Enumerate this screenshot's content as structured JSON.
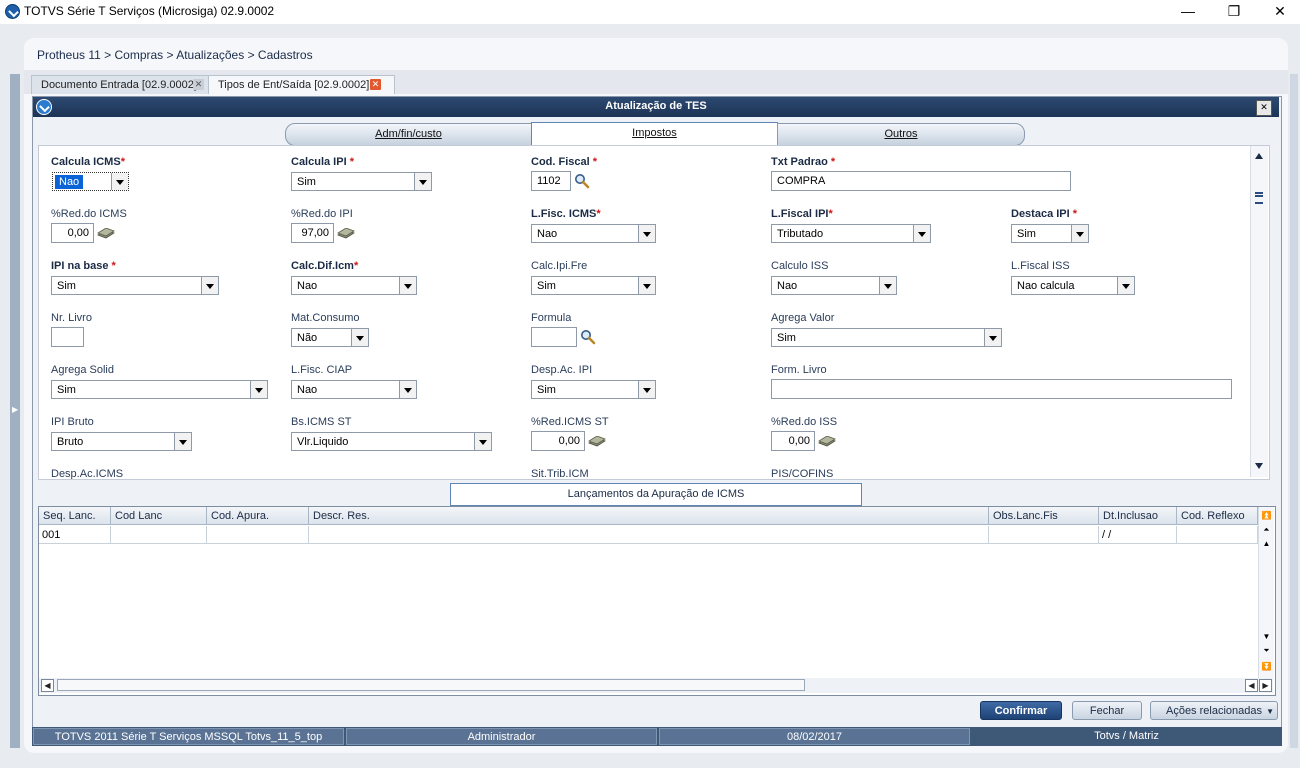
{
  "window": {
    "title": "TOTVS Série T Serviços (Microsiga) 02.9.0002",
    "minimize": "—",
    "maximize": "❐",
    "close": "✕"
  },
  "breadcrumb": "Protheus 11 > Compras  > Atualizações > Cadastros",
  "tabs": [
    {
      "label": "Documento Entrada [02.9.0002]",
      "close": "✕"
    },
    {
      "label": "Tipos de Ent/Saída [02.9.0002]",
      "close": "✕"
    }
  ],
  "dialog": {
    "title": "Atualização de TES",
    "close": "✕"
  },
  "folder_tabs": [
    "Adm/fin/custo",
    "Impostos",
    "Outros"
  ],
  "required_mark": "*",
  "fields": {
    "calcula_icms": {
      "label": "Calcula ICMS",
      "value": "Nao"
    },
    "calcula_ipi": {
      "label": "Calcula IPI ",
      "value": "Sim"
    },
    "cod_fiscal": {
      "label": "Cod. Fiscal ",
      "value": "1102"
    },
    "txt_padrao": {
      "label": "Txt Padrao ",
      "value": "COMPRA"
    },
    "red_icms": {
      "label": "%Red.do ICMS",
      "value": "0,00"
    },
    "red_ipi": {
      "label": "%Red.do IPI",
      "value": "97,00"
    },
    "lfisc_icms": {
      "label": "L.Fisc. ICMS",
      "value": "Nao"
    },
    "lfiscal_ipi": {
      "label": "L.Fiscal IPI",
      "value": "Tributado"
    },
    "destaca_ipi": {
      "label": "Destaca IPI ",
      "value": "Sim"
    },
    "ipi_na_base": {
      "label": "IPI na base ",
      "value": "Sim"
    },
    "calc_dif_icm": {
      "label": "Calc.Dif.Icm",
      "value": "Nao"
    },
    "calc_ipi_fre": {
      "label": "Calc.Ipi.Fre",
      "value": "Sim"
    },
    "calculo_iss": {
      "label": "Calculo ISS",
      "value": "Nao"
    },
    "lfiscal_iss": {
      "label": "L.Fiscal ISS",
      "value": "Nao calcula"
    },
    "nr_livro": {
      "label": "Nr. Livro",
      "value": ""
    },
    "mat_consumo": {
      "label": "Mat.Consumo",
      "value": "Não"
    },
    "formula": {
      "label": "Formula",
      "value": ""
    },
    "agrega_valor": {
      "label": "Agrega Valor",
      "value": "Sim"
    },
    "agrega_solid": {
      "label": "Agrega Solid",
      "value": "Sim"
    },
    "lfisc_ciap": {
      "label": "L.Fisc. CIAP",
      "value": "Nao"
    },
    "desp_ac_ipi": {
      "label": "Desp.Ac. IPI",
      "value": "Sim"
    },
    "form_livro": {
      "label": "Form. Livro",
      "value": ""
    },
    "ipi_bruto": {
      "label": "IPI Bruto",
      "value": "Bruto"
    },
    "bs_icms_st": {
      "label": "Bs.ICMS ST",
      "value": "Vlr.Liquido"
    },
    "red_icms_st": {
      "label": "%Red.ICMS ST",
      "value": "0,00"
    },
    "red_iss": {
      "label": "%Red.do ISS",
      "value": "0,00"
    },
    "desp_ac_icms": {
      "label": "Desp.Ac.ICMS"
    },
    "sit_trib_icm": {
      "label": "Sit.Trib.ICM"
    },
    "pis_cofins": {
      "label": "PIS/COFINS"
    }
  },
  "grid": {
    "title": "Lançamentos da Apuração de ICMS",
    "columns": [
      "Seq. Lanc.",
      "Cod Lanc",
      "Cod. Apura.",
      "Descr. Res.",
      "Obs.Lanc.Fis",
      "Dt.Inclusao",
      "Cod. Reflexo"
    ],
    "rows": [
      [
        "001",
        "",
        "",
        "",
        "",
        " / /",
        ""
      ]
    ]
  },
  "buttons": {
    "confirm": "Confirmar",
    "close": "Fechar",
    "actions": "Ações relacionadas"
  },
  "status": [
    "TOTVS 2011 Série T Serviços MSSQL Totvs_11_5_top",
    "Administrador",
    "08/02/2017",
    "Totvs / Matriz"
  ],
  "colors": {
    "header": "#1c3355",
    "accent": "#1e4275",
    "required": "#d21414",
    "status_bar": "#3e5878"
  }
}
